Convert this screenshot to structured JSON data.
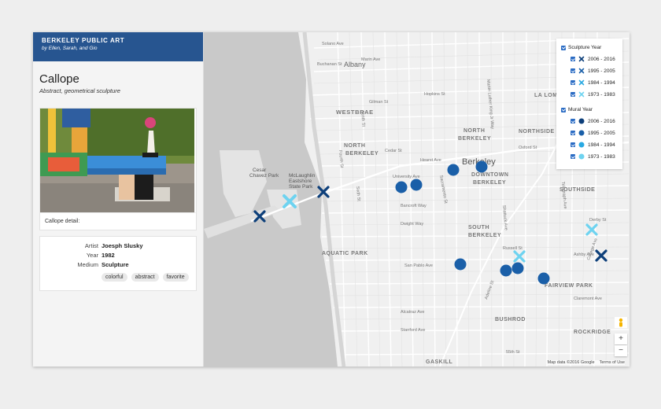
{
  "brand": {
    "title": "BERKELEY PUBLIC ART",
    "subtitle": "by Ellen, Sarah, and Gio"
  },
  "artwork": {
    "title": "Callope",
    "subtitle": "Abstract, geometrical sculpture",
    "detail_label": "Callope detail:",
    "fields": [
      {
        "key": "Artist",
        "value": "Joesph Slusky"
      },
      {
        "key": "Year",
        "value": "1982"
      },
      {
        "key": "Medium",
        "value": "Sculpture"
      }
    ],
    "tags": [
      "colorful",
      "abstract",
      "favorite"
    ]
  },
  "legend": {
    "sculpture_header": "Sculpture Year",
    "mural_header": "Mural Year",
    "sculpture_items": [
      {
        "label": "2006 - 2016",
        "color": "#0d3f7a",
        "icon": "x-marker"
      },
      {
        "label": "1995 - 2005",
        "color": "#1a5fa8",
        "icon": "x-marker"
      },
      {
        "label": "1984 - 1994",
        "color": "#29a9e2",
        "icon": "x-marker"
      },
      {
        "label": "1973 - 1983",
        "color": "#6ed3f0",
        "icon": "x-marker"
      }
    ],
    "mural_items": [
      {
        "label": "2006 - 2016",
        "color": "#0d3f7a",
        "icon": "dot-marker"
      },
      {
        "label": "1995 - 2005",
        "color": "#1a5fa8",
        "icon": "dot-marker"
      },
      {
        "label": "1984 - 1994",
        "color": "#29a9e2",
        "icon": "dot-marker"
      },
      {
        "label": "1973 - 1983",
        "color": "#6ed3f0",
        "icon": "dot-marker"
      }
    ]
  },
  "map": {
    "neighborhoods": [
      "WESTBRAE",
      "NORTH BERKELEY",
      "NORTH BERKELEY",
      "DOWNTOWN BERKELEY",
      "SOUTHSIDE",
      "SOUTH BERKELEY",
      "AQUATIC PARK",
      "FAIRVIEW PARK",
      "BUSHROD",
      "ROCKRIDGE",
      "GASKILL",
      "LA LOMA",
      "NORTHSIDE",
      "Berkeley"
    ],
    "parks": [
      "Cesar Chavez Park",
      "McLaughlin Eastshore State Park"
    ],
    "streets": [
      "Albany",
      "Solano Ave",
      "Marin Ave",
      "Buchanan St",
      "Hopkins St",
      "Gilman St",
      "University Ave",
      "Hearst Ave",
      "Dwight Way",
      "Ashby Ave",
      "Alcatraz Ave",
      "Stanford Ave",
      "San Pablo Ave",
      "Sacramento St",
      "Shattuck Ave",
      "Telegraph Ave",
      "College Ave",
      "Adeline St",
      "Derby St",
      "Russell St",
      "Cedar St",
      "Bancroft Way",
      "Fourth St",
      "Sixth St",
      "Ninth St",
      "Tenth St",
      "Martin Luther King Jr Way",
      "55th St",
      "Claremont Ave",
      "Euclid Ave",
      "Oxford St"
    ],
    "attribution": "Map data ©2016 Google",
    "terms": "Terms of Use",
    "zoom_in": "+",
    "zoom_out": "−"
  }
}
